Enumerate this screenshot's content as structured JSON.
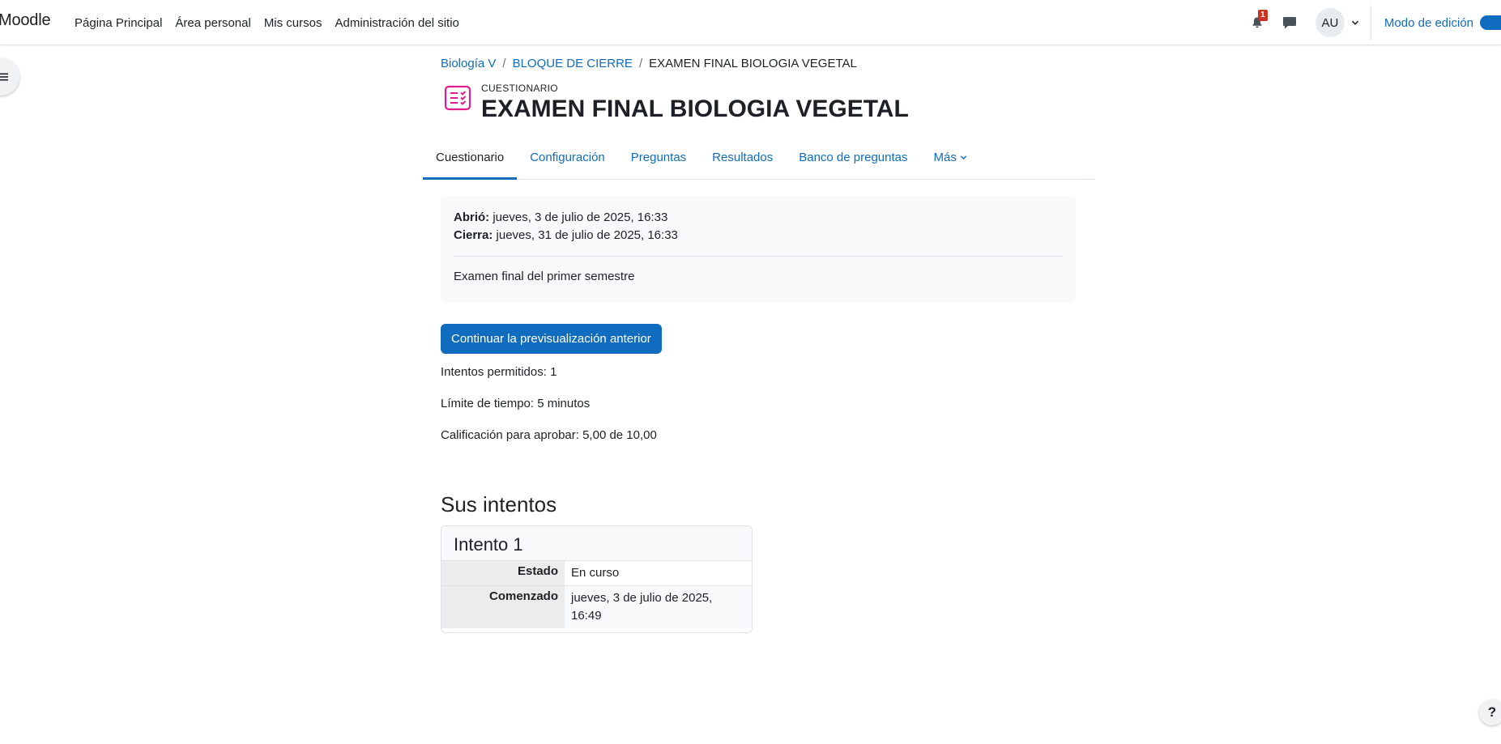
{
  "navbar": {
    "brand": "Moodle",
    "items": [
      {
        "label": "Página Principal"
      },
      {
        "label": "Área personal"
      },
      {
        "label": "Mis cursos"
      },
      {
        "label": "Administración del sitio"
      }
    ],
    "notification_count": "1",
    "avatar_initials": "AU",
    "edit_mode_label": "Modo de edición"
  },
  "breadcrumb": {
    "items": [
      "Biología V",
      "BLOQUE DE CIERRE"
    ],
    "current": "EXAMEN FINAL BIOLOGIA VEGETAL"
  },
  "header": {
    "pretitle": "CUESTIONARIO",
    "title": "EXAMEN FINAL BIOLOGIA VEGETAL"
  },
  "tabs": [
    {
      "label": "Cuestionario",
      "active": true
    },
    {
      "label": "Configuración"
    },
    {
      "label": "Preguntas"
    },
    {
      "label": "Resultados"
    },
    {
      "label": "Banco de preguntas"
    },
    {
      "label": "Más"
    }
  ],
  "dates": {
    "opened_label": "Abrió:",
    "opened_value": "jueves, 3 de julio de 2025, 16:33",
    "closes_label": "Cierra:",
    "closes_value": "jueves, 31 de julio de 2025, 16:33"
  },
  "description": "Examen final del primer semestre",
  "continue_button": "Continuar la previsualización anterior",
  "meta": {
    "attempts_allowed": "Intentos permitidos: 1",
    "time_limit": "Límite de tiempo: 5 minutos",
    "grade_to_pass": "Calificación para aprobar: 5,00 de 10,00"
  },
  "attempts": {
    "section_title": "Sus intentos",
    "attempt_title": "Intento 1",
    "rows": [
      {
        "label": "Estado",
        "value": "En curso"
      },
      {
        "label": "Comenzado",
        "value": "jueves, 3 de julio de 2025, 16:49"
      }
    ]
  },
  "help_label": "?",
  "colors": {
    "accent": "#0f6cbf",
    "quiz_icon": "#e01e8b",
    "badge": "#ca3120"
  },
  "icons": {
    "drawer": "hamburger-icon",
    "notifications": "bell-icon",
    "messages": "chat-icon",
    "avatar_menu": "chevron-down-icon",
    "activity": "quiz-icon",
    "more_tab": "chevron-down-icon"
  }
}
